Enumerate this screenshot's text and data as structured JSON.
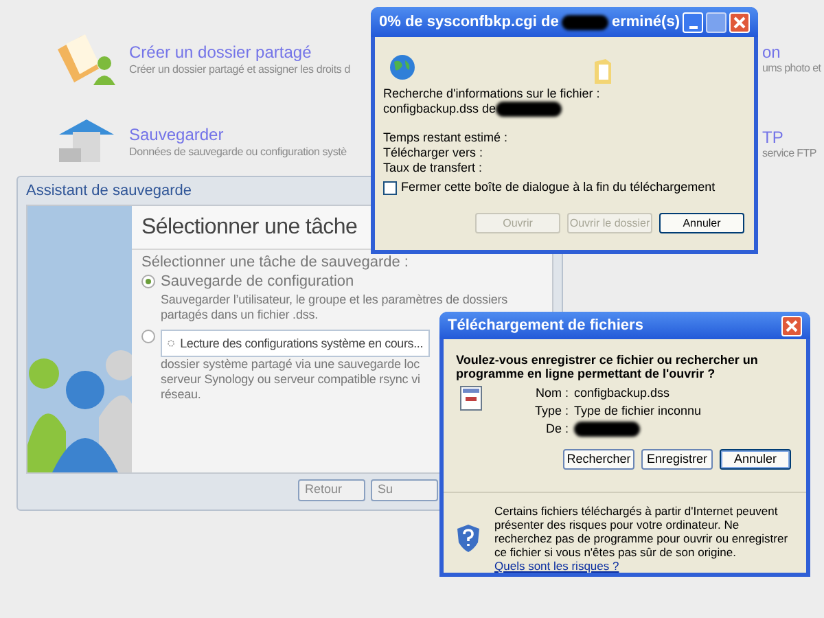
{
  "background_items": [
    {
      "title": "Créer un dossier partagé",
      "description": "Créer un dossier partagé et assigner les droits d"
    },
    {
      "title": "Sauvegarder",
      "description": "Données de sauvegarde ou configuration systè"
    }
  ],
  "background_items_right": [
    {
      "title": "on",
      "description": "ums photo et"
    },
    {
      "title": "TP",
      "description": "service FTP"
    }
  ],
  "wizard": {
    "title": "Assistant de sauvegarde",
    "heading": "Sélectionner une tâche",
    "prompt": "Sélectionner une tâche de sauvegarde :",
    "options": [
      {
        "label": "Sauvegarde de configuration",
        "selected": true,
        "description": [
          "Sauvegarder l’utilisateur, le groupe et les paramètres de dossiers",
          "partagés dans un fichier .dss."
        ]
      },
      {
        "selected": false,
        "description": [
          "dossier système partagé via une sauvegarde loc",
          "serveur Synology ou serveur compatible rsync vi",
          "réseau."
        ]
      }
    ],
    "loading": "Lecture des configurations système en cours...",
    "buttons": [
      "Retour",
      "Su"
    ]
  },
  "progress_window": {
    "title_start": "0% de sysconfbkp.cgi de",
    "title_end": "erminé(s)",
    "lookup": "Recherche d'informations sur le fichier :",
    "file": "configbackup.dss de",
    "fields": [
      "Temps restant estimé :",
      "Télécharger vers :",
      "Taux de transfert :"
    ],
    "close_when_done": {
      "label": "Fermer cette boîte de dialogue à la fin du téléchargement",
      "checked": false
    },
    "buttons": [
      {
        "label": "Ouvrir",
        "disabled": true
      },
      {
        "label": "Ouvrir le dossier",
        "disabled": true
      },
      {
        "label": "Annuler",
        "disabled": false
      }
    ]
  },
  "download_dialog": {
    "title": "Téléchargement de fichiers",
    "question": "Voulez-vous enregistrer ce fichier ou rechercher un programme en ligne permettant de l'ouvrir ?",
    "fields": [
      {
        "label": "Nom :",
        "value": "configbackup.dss"
      },
      {
        "label": "Type :",
        "value": "Type de fichier inconnu"
      },
      {
        "label": "De :"
      }
    ],
    "buttons": [
      "Rechercher",
      "Enregistrer",
      "Annuler"
    ],
    "warning": "Certains fichiers téléchargés à partir d'Internet peuvent présenter des risques pour votre ordinateur. Ne recherchez pas de programme pour ouvrir ou enregistrer ce fichier si vous n'êtes pas sûr de son origine.",
    "link": "Quels sont les risques ?"
  }
}
